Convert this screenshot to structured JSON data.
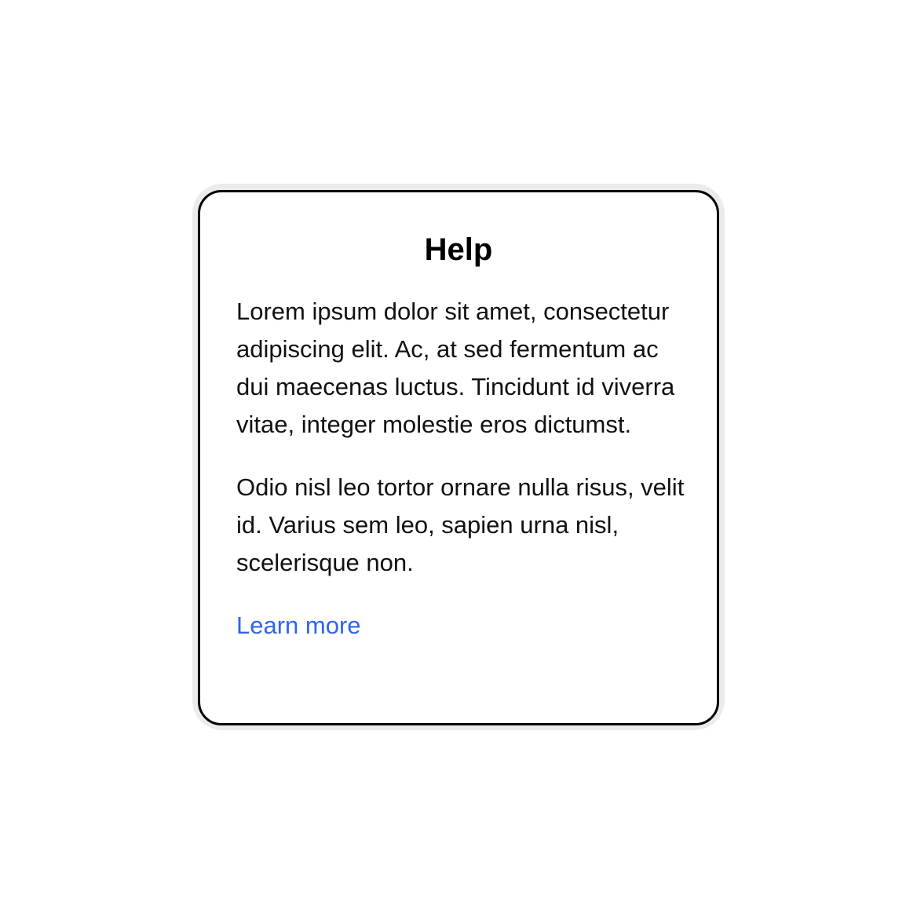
{
  "help_card": {
    "title": "Help",
    "paragraphs": [
      "Lorem ipsum dolor sit amet, consectetur adipiscing elit. Ac, at sed fermentum ac dui maecenas luctus. Tincidunt id viverra vitae, integer molestie eros dictumst.",
      "Odio nisl leo tortor ornare nulla risus, velit id. Varius sem leo, sapien urna nisl, scelerisque non."
    ],
    "link_label": "Learn more"
  },
  "colors": {
    "link": "#2f66e8",
    "border": "#000000",
    "halo": "#ebebeb",
    "background": "#ffffff"
  }
}
